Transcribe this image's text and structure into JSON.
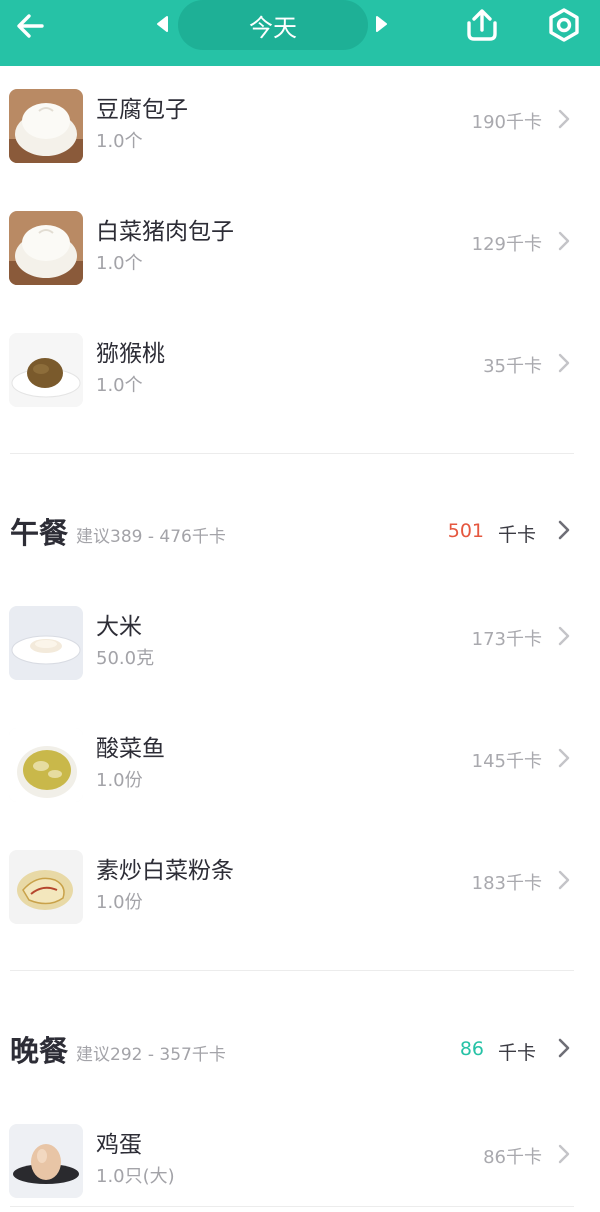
{
  "header": {
    "date_label": "今天",
    "accent_color": "#26c2a6"
  },
  "icons": {
    "back": "back-arrow-icon",
    "prev": "triangle-left-icon",
    "next": "triangle-right-icon",
    "share": "upload-icon",
    "settings": "gear-icon",
    "chevron": "chevron-right-icon"
  },
  "breakfast_items": [
    {
      "name": "豆腐包子",
      "qty": "1.0个",
      "kcal": "190千卡",
      "thumb": "bun"
    },
    {
      "name": "白菜猪肉包子",
      "qty": "1.0个",
      "kcal": "129千卡",
      "thumb": "bun"
    },
    {
      "name": "猕猴桃",
      "qty": "1.0个",
      "kcal": "35千卡",
      "thumb": "kiwi"
    }
  ],
  "lunch": {
    "title": "午餐",
    "suggestion": "建议389 - 476千卡",
    "total": "501",
    "unit": "千卡",
    "total_color": "#e5573f",
    "items": [
      {
        "name": "大米",
        "qty": "50.0克",
        "kcal": "173千卡",
        "thumb": "rice"
      },
      {
        "name": "酸菜鱼",
        "qty": "1.0份",
        "kcal": "145千卡",
        "thumb": "soup"
      },
      {
        "name": "素炒白菜粉条",
        "qty": "1.0份",
        "kcal": "183千卡",
        "thumb": "cabbage"
      }
    ]
  },
  "dinner": {
    "title": "晚餐",
    "suggestion": "建议292 - 357千卡",
    "total": "86",
    "unit": "千卡",
    "total_color": "#26c2a6",
    "items": [
      {
        "name": "鸡蛋",
        "qty": "1.0只(大)",
        "kcal": "86千卡",
        "thumb": "egg"
      }
    ]
  }
}
